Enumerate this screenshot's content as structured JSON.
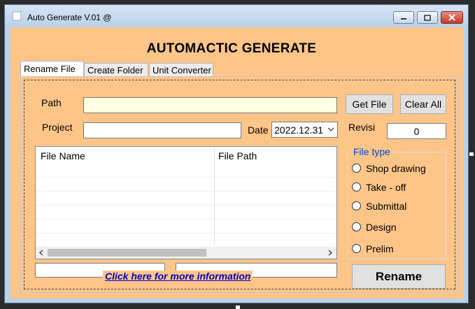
{
  "window": {
    "title": "Auto Generate V.01 @",
    "controls": {
      "minimize": "minimize",
      "maximize": "maximize",
      "close": "close"
    }
  },
  "heading": "AUTOMACTIC GENERATE",
  "tabs": [
    {
      "label": "Rename File",
      "active": true
    },
    {
      "label": "Create Folder",
      "active": false
    },
    {
      "label": "Unit Converter",
      "active": false
    }
  ],
  "form": {
    "path_label": "Path",
    "path_value": "",
    "project_label": "Project",
    "project_value": "",
    "date_label": "Date",
    "date_value": "2022.12.31",
    "revisi_label": "Revisi",
    "revisi_value": "0"
  },
  "buttons": {
    "get_file": "Get File",
    "clear_all": "Clear All",
    "rename": "Rename"
  },
  "file_list": {
    "columns": [
      "File Name",
      "File Path"
    ],
    "rows": []
  },
  "file_type": {
    "title": "File type",
    "options": [
      "Shop drawing",
      "Take - off",
      "Submittal",
      "Design",
      "Prelim"
    ]
  },
  "info_link": "Click here for more information",
  "colors": {
    "client_bg": "#fec589",
    "path_field_bg": "#ffffe1",
    "link": "#0000cc",
    "group_title": "#0046d5"
  },
  "icons": {
    "app": "app-icon",
    "date_dropdown": "chevron-down-icon"
  }
}
